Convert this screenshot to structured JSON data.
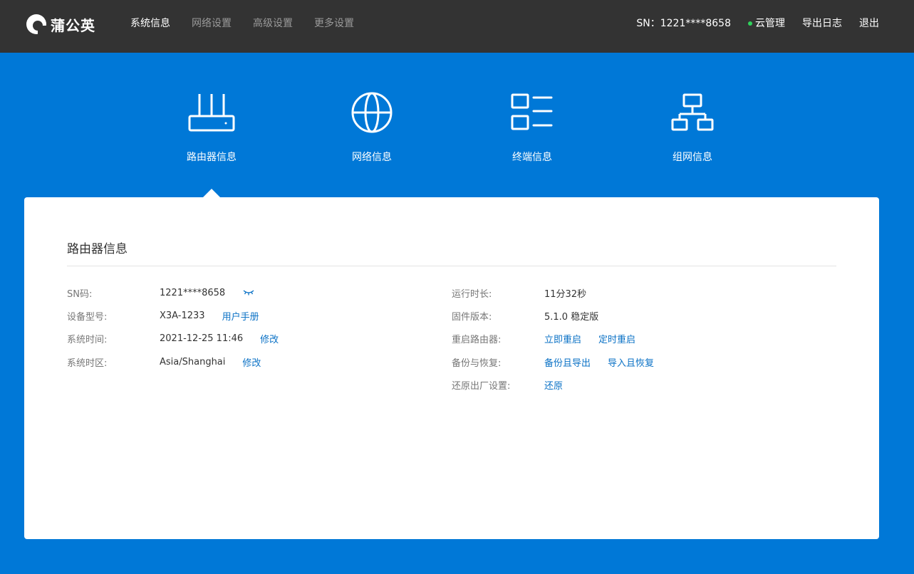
{
  "brand": {
    "name": "蒲公英"
  },
  "nav": [
    {
      "label": "系统信息",
      "active": true
    },
    {
      "label": "网络设置",
      "active": false
    },
    {
      "label": "高级设置",
      "active": false
    },
    {
      "label": "更多设置",
      "active": false
    }
  ],
  "header": {
    "sn_text": "SN：1221****8658",
    "cloud_label": "云管理",
    "cloud_status_color": "#2fd15b",
    "export_log": "导出日志",
    "logout": "退出"
  },
  "tabs": [
    {
      "label": "路由器信息",
      "icon": "router-icon",
      "selected": true
    },
    {
      "label": "网络信息",
      "icon": "globe-icon",
      "selected": false
    },
    {
      "label": "终端信息",
      "icon": "device-list-icon",
      "selected": false
    },
    {
      "label": "组网信息",
      "icon": "network-topology-icon",
      "selected": false
    }
  ],
  "panel": {
    "title": "路由器信息",
    "left": [
      {
        "label": "SN码:",
        "value": "1221****8658",
        "eye_icon": "eye-closed-icon"
      },
      {
        "label": "设备型号:",
        "value": "X3A-1233",
        "link": "用户手册"
      },
      {
        "label": "系统时间:",
        "value": "2021-12-25 11:46",
        "link": "修改"
      },
      {
        "label": "系统时区:",
        "value": "Asia/Shanghai",
        "link": "修改"
      }
    ],
    "right": [
      {
        "label": "运行时长:",
        "value": "11分32秒"
      },
      {
        "label": "固件版本:",
        "value": "5.1.0 稳定版"
      },
      {
        "label": "重启路由器:",
        "links": [
          "立即重启",
          "定时重启"
        ]
      },
      {
        "label": "备份与恢复:",
        "links": [
          "备份且导出",
          "导入且恢复"
        ]
      },
      {
        "label": "还原出厂设置:",
        "links": [
          "还原"
        ]
      }
    ]
  },
  "colors": {
    "topbar": "#333333",
    "background": "#0078d7",
    "link": "#0b72c6"
  }
}
